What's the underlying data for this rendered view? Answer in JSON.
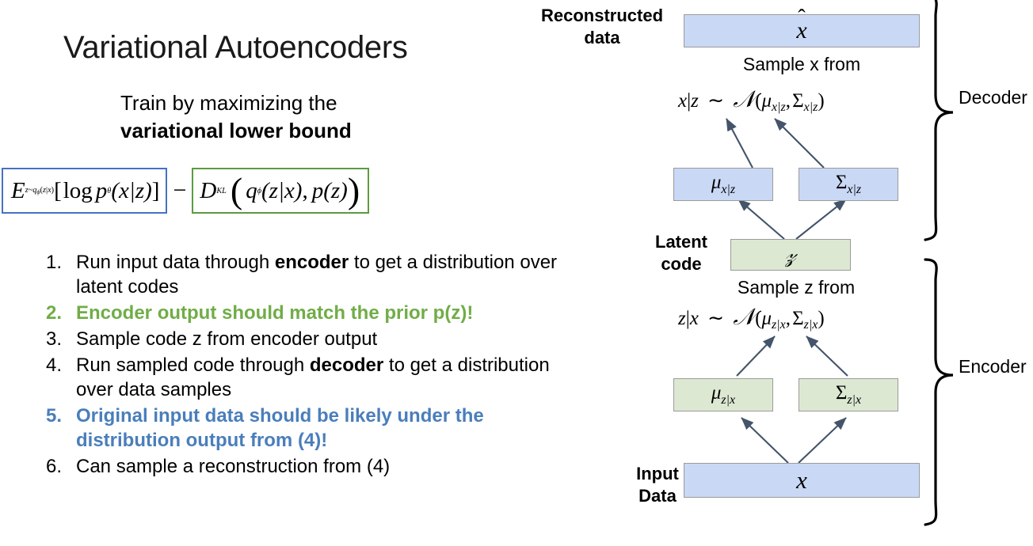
{
  "slide": {
    "title": "Variational Autoencoders",
    "subtitle_line1": "Train by maximizing the",
    "subtitle_line2": "variational lower bound"
  },
  "formula": {
    "reconstruction_term": {
      "E": "E",
      "E_subscript": "z~qϕ(z|x)",
      "bracket_open": "[",
      "log": "log",
      "p": "p",
      "p_subscript": "θ",
      "arg": "(x|z)",
      "bracket_close": "]",
      "border_color": "#4472c4"
    },
    "minus": "−",
    "kl_term": {
      "D": "D",
      "D_subscript": "KL",
      "paren_open": "(",
      "q": "q",
      "q_subscript": "ϕ",
      "q_arg": "(z|x)",
      "comma": ",",
      "p": "p",
      "p_arg": "(z)",
      "paren_close": ")",
      "border_color": "#5b9b40"
    }
  },
  "steps": [
    {
      "number": "1.",
      "style": "plain",
      "parts": [
        {
          "t": "Run input data through ",
          "b": false
        },
        {
          "t": "encoder",
          "b": true
        },
        {
          "t": " to get a distribution over latent codes",
          "b": false
        }
      ]
    },
    {
      "number": "2.",
      "style": "green",
      "parts": [
        {
          "t": "Encoder output should match the prior p(z)!",
          "b": false
        }
      ]
    },
    {
      "number": "3.",
      "style": "plain",
      "parts": [
        {
          "t": "Sample code z from encoder output",
          "b": false
        }
      ]
    },
    {
      "number": "4.",
      "style": "plain",
      "parts": [
        {
          "t": "Run sampled code through ",
          "b": false
        },
        {
          "t": "decoder",
          "b": true
        },
        {
          "t": " to get a distribution over data samples",
          "b": false
        }
      ]
    },
    {
      "number": "5.",
      "style": "blue",
      "parts": [
        {
          "t": "Original input data should be likely under the distribution output from (4)!",
          "b": false
        }
      ]
    },
    {
      "number": "6.",
      "style": "plain",
      "parts": [
        {
          "t": "Can sample a reconstruction from (4)",
          "b": false
        }
      ]
    }
  ],
  "diagram": {
    "labels": {
      "reconstructed_data_line1": "Reconstructed",
      "reconstructed_data_line2": "data",
      "latent_code_line1": "Latent",
      "latent_code_line2": "code",
      "input_data_line1": "Input",
      "input_data_line2": "Data",
      "decoder": "Decoder",
      "encoder": "Encoder"
    },
    "captions": {
      "sample_x": "Sample x from",
      "sample_z": "Sample z from"
    },
    "math": {
      "decoder_dist_lhs": "x|z",
      "decoder_dist_tilde": "~",
      "decoder_dist_N": "N",
      "decoder_dist_args": "(μ x|z , Σ x|z )",
      "encoder_dist_lhs": "z|x",
      "encoder_dist_tilde": "~",
      "encoder_dist_N": "N",
      "encoder_dist_args": "(μ z|x , Σ z|x )"
    },
    "nodes": {
      "xhat": {
        "symbol": "x̂",
        "color": "blue"
      },
      "mu_x_given_z": {
        "symbol": "μ",
        "sub": "x|z",
        "color": "blue"
      },
      "sigma_x_given_z": {
        "symbol": "Σ",
        "sub": "x|z",
        "color": "blue"
      },
      "z": {
        "symbol": "z",
        "color": "green"
      },
      "mu_z_given_x": {
        "symbol": "μ",
        "sub": "z|x",
        "color": "green"
      },
      "sigma_z_given_x": {
        "symbol": "Σ",
        "sub": "z|x",
        "color": "green"
      },
      "x": {
        "symbol": "x",
        "color": "blue"
      }
    }
  },
  "colors": {
    "box_blue": "#c9d8f5",
    "box_green": "#dde8d2",
    "text_green": "#70ad47",
    "text_blue": "#4a7ebb",
    "border_blue": "#4472c4",
    "border_green": "#5b9b40",
    "arrow": "#44546a"
  }
}
